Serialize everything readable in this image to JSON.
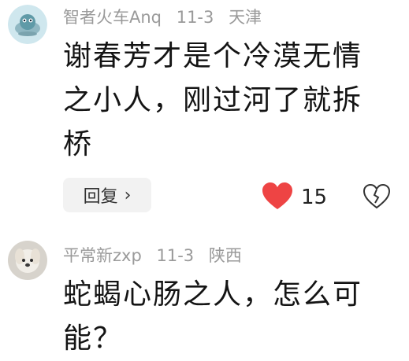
{
  "comments": [
    {
      "username": "智者火车Anq",
      "date": "11-3",
      "location": "天津",
      "text": "谢春芳才是个冷漠无情之小人，刚过河了就拆桥",
      "reply_label": "回复",
      "likes": "15",
      "avatar": "cartoon-alien-avatar",
      "like_icon": "heart-icon",
      "like_color": "#ee4444",
      "dislike_icon": "broken-heart-icon"
    },
    {
      "username": "平常新zxp",
      "date": "11-3",
      "location": "陕西",
      "text": "蛇蝎心肠之人，怎么可能？",
      "avatar": "dog-photo-avatar"
    }
  ],
  "colors": {
    "meta": "#9a9a9a",
    "text": "#141414",
    "reply_bg": "#f2f2f2"
  }
}
